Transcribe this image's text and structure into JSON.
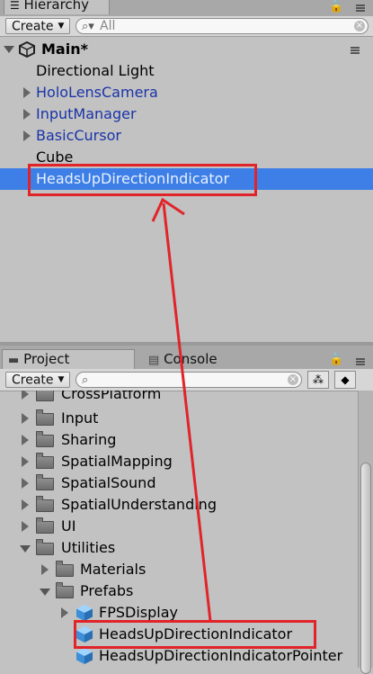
{
  "hierarchy": {
    "tab_label": "Hierarchy",
    "create_label": "Create",
    "search_placeholder": "All",
    "scene_name": "Main*",
    "items": [
      {
        "label": "Directional Light",
        "has_children": false,
        "prefab": false
      },
      {
        "label": "HoloLensCamera",
        "has_children": true,
        "prefab": true
      },
      {
        "label": "InputManager",
        "has_children": true,
        "prefab": true
      },
      {
        "label": "BasicCursor",
        "has_children": true,
        "prefab": true
      },
      {
        "label": "Cube",
        "has_children": false,
        "prefab": false
      },
      {
        "label": "HeadsUpDirectionIndicator",
        "has_children": false,
        "prefab": false,
        "selected": true
      }
    ]
  },
  "project": {
    "tab_label": "Project",
    "console_tab_label": "Console",
    "create_label": "Create",
    "search_placeholder": "",
    "tree": [
      {
        "label": "CrossPlatform",
        "type": "folder",
        "depth": 1,
        "expanded": false
      },
      {
        "label": "Input",
        "type": "folder",
        "depth": 1,
        "expanded": false
      },
      {
        "label": "Sharing",
        "type": "folder",
        "depth": 1,
        "expanded": false
      },
      {
        "label": "SpatialMapping",
        "type": "folder",
        "depth": 1,
        "expanded": false
      },
      {
        "label": "SpatialSound",
        "type": "folder",
        "depth": 1,
        "expanded": false
      },
      {
        "label": "SpatialUnderstanding",
        "type": "folder",
        "depth": 1,
        "expanded": false
      },
      {
        "label": "UI",
        "type": "folder",
        "depth": 1,
        "expanded": false
      },
      {
        "label": "Utilities",
        "type": "folder",
        "depth": 1,
        "expanded": true
      },
      {
        "label": "Materials",
        "type": "folder",
        "depth": 2,
        "expanded": false
      },
      {
        "label": "Prefabs",
        "type": "folder",
        "depth": 2,
        "expanded": true
      },
      {
        "label": "FPSDisplay",
        "type": "prefab",
        "depth": 3,
        "expandable": true
      },
      {
        "label": "HeadsUpDirectionIndicator",
        "type": "prefab",
        "depth": 3,
        "expandable": false
      },
      {
        "label": "HeadsUpDirectionIndicatorPointer",
        "type": "prefab",
        "depth": 3,
        "expandable": false
      }
    ]
  },
  "colors": {
    "selection": "#3d7fe6",
    "annotation": "#e0242a",
    "prefab_text": "#1a34a8"
  }
}
